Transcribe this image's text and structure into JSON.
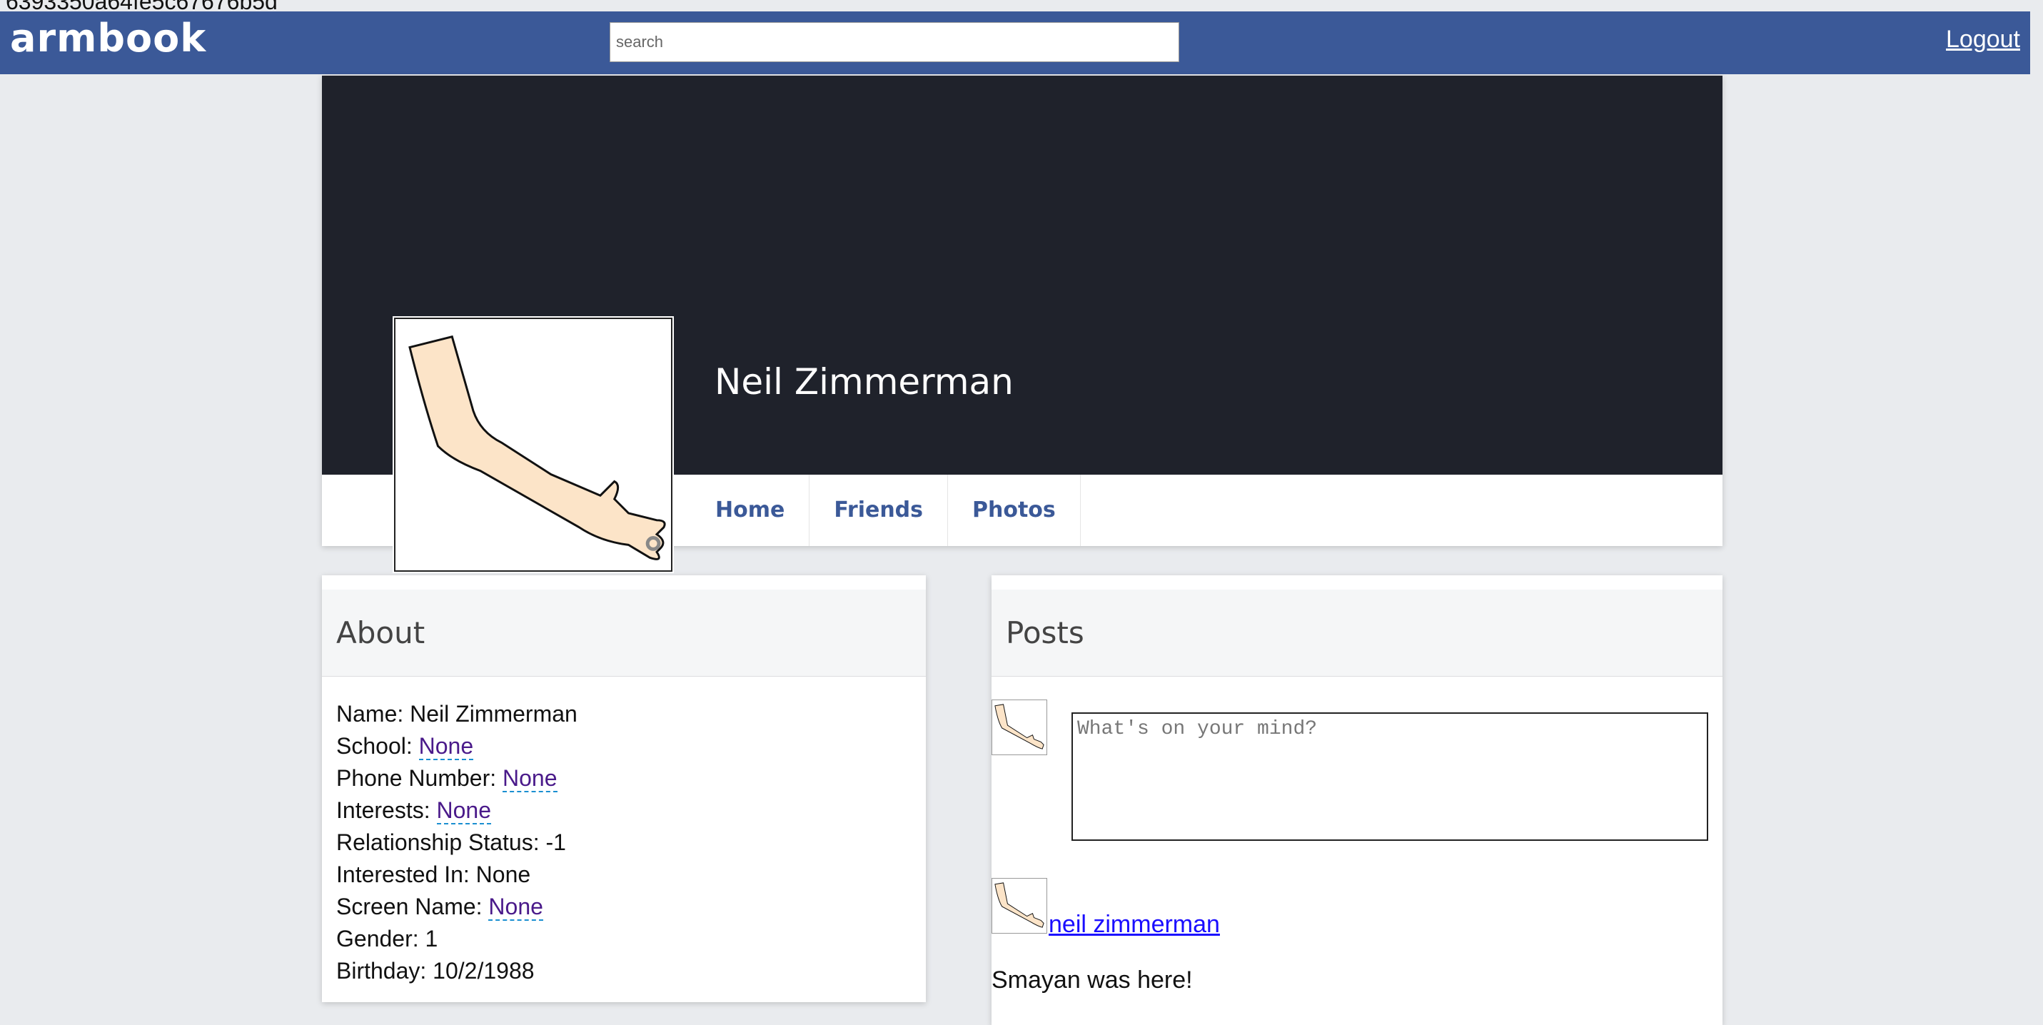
{
  "top_strip": {
    "text": "6393350a64fe5c67676b5d"
  },
  "navbar": {
    "brand": "armbook",
    "search_placeholder": "search",
    "logout_label": "Logout"
  },
  "profile": {
    "name": "Neil Zimmerman",
    "avatar_icon": "arm-icon",
    "tabs": [
      "Home",
      "Friends",
      "Photos"
    ]
  },
  "about": {
    "title": "About",
    "rows": [
      {
        "label": "Name: ",
        "value": "Neil Zimmerman",
        "editable": false
      },
      {
        "label": "School: ",
        "value": "None",
        "editable": true
      },
      {
        "label": "Phone Number: ",
        "value": "None",
        "editable": true
      },
      {
        "label": "Interests: ",
        "value": "None",
        "editable": true
      },
      {
        "label": "Relationship Status: ",
        "value": "-1",
        "editable": false
      },
      {
        "label": "Interested In: ",
        "value": "None",
        "editable": false
      },
      {
        "label": "Screen Name: ",
        "value": "None",
        "editable": true
      },
      {
        "label": "Gender: ",
        "value": "1",
        "editable": false
      },
      {
        "label": "Birthday: ",
        "value": "10/2/1988",
        "editable": false
      }
    ]
  },
  "posts": {
    "title": "Posts",
    "composer_placeholder": "What's on your mind?",
    "items": [
      {
        "author": "neil zimmerman",
        "text": "Smayan was here!"
      }
    ]
  },
  "colors": {
    "navbar": "#3b5998",
    "cover": "#1f222b",
    "link": "#3b5998",
    "editable_text": "#4a1a8a"
  }
}
